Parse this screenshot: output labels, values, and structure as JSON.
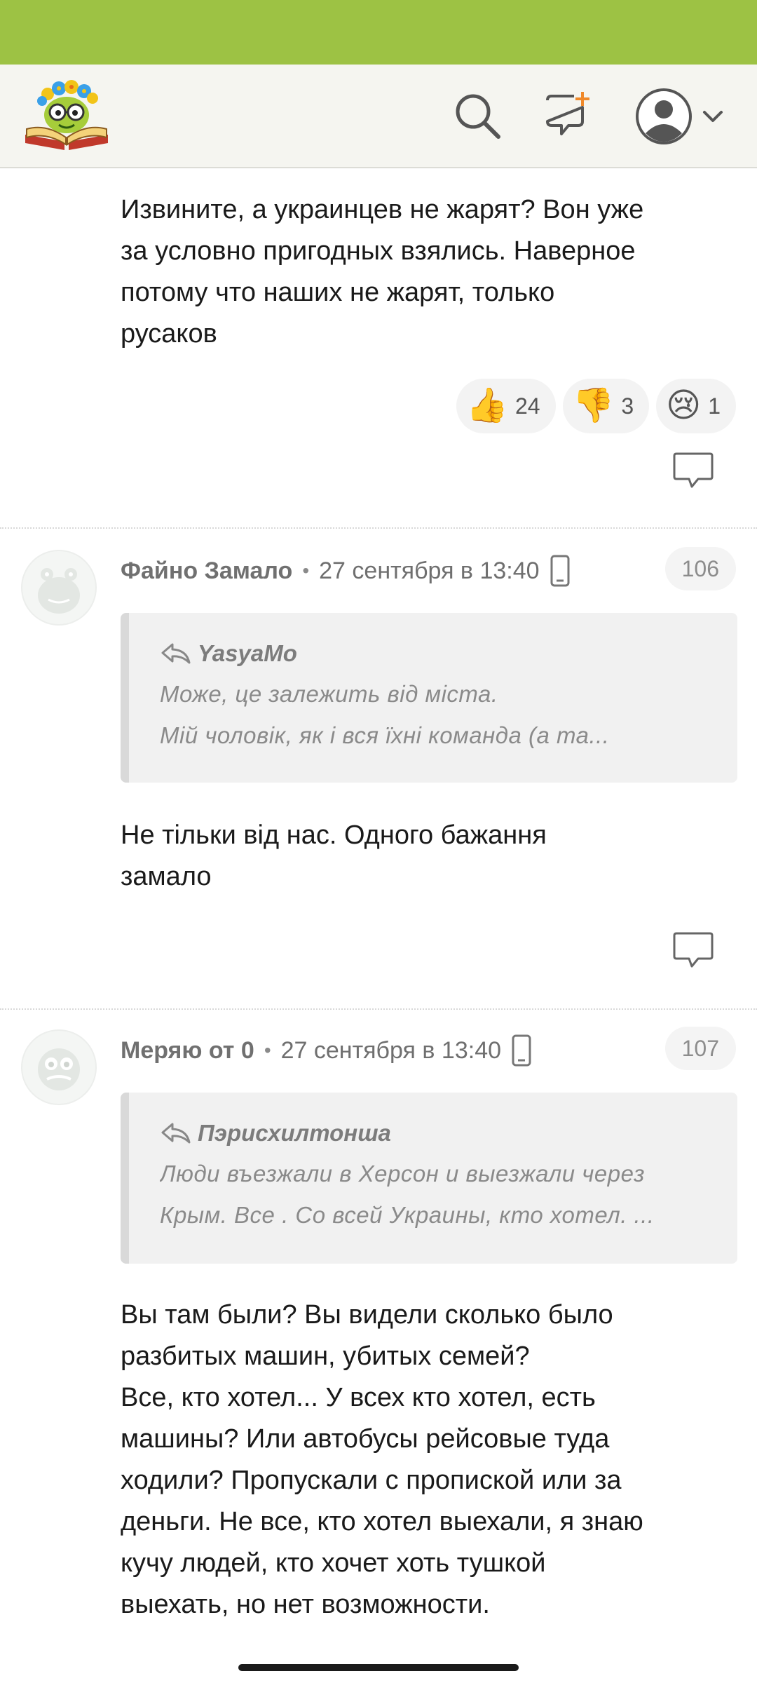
{
  "header": {
    "logo_name": "site-logo",
    "icons": [
      "search-icon",
      "new-post-icon",
      "user-avatar-icon",
      "chevron-down-icon"
    ],
    "accent_color": "#9dc244"
  },
  "first_comment": {
    "text": "Извините, а украинцев не жарят? Вон уже\nза условно пригодных взялись. Наверное\nпотому что наших не жарят, только\nрусаков",
    "reactions": [
      {
        "icon": "thumbs-up-icon",
        "emoji": "👍",
        "count": "24"
      },
      {
        "icon": "thumbs-down-icon",
        "emoji": "👎",
        "count": "3"
      },
      {
        "icon": "crying-face-icon",
        "emoji": "😢",
        "count": "1"
      }
    ]
  },
  "comments": [
    {
      "author": "Файно Замало",
      "date": "27 сентября в 13:40",
      "number": "106",
      "quote_author": "YasyaMo",
      "quote_line1": "Може, це залежить від міста.",
      "quote_line2": "Мій чоловік, як і вся їхні команда (а та...",
      "text": "Не тільки від нас. Одного бажання\nзамало"
    },
    {
      "author": "Меряю от 0",
      "date": "27 сентября в 13:40",
      "number": "107",
      "quote_author": "Пэрисхилтонша",
      "quote_line1": "Люди въезжали в Херсон и выезжали через",
      "quote_line2": "Крым. Все . Со всей Украины, кто хотел. ...",
      "text": "Вы там были? Вы видели сколько было\nразбитых машин, убитых семей?\nВсе, кто хотел... У всех кто хотел, есть\nмашины? Или автобусы рейсовые туда\nходили? Пропускали с пропиской или за\nденьги. Не все, кто хотел выехали, я знаю\nкучу людей, кто хочет хоть тушкой\nвыехать, но нет возможности."
    }
  ]
}
